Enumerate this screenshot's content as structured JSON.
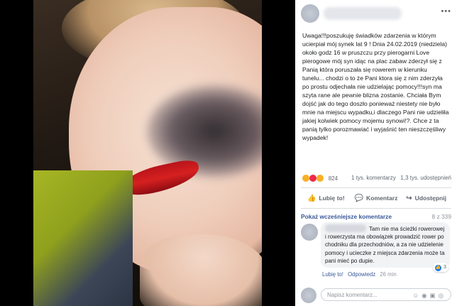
{
  "photo": {},
  "post": {
    "text": "Uwaga!!!poszukuję świadków zdarzenia w którym ucierpiał mój synek lat 9 ! Dnia 24.02.2019 (niedziela) około godz 16 w pruszczu przy pierogarni Love pierogowe mój syn idąc na plac zabaw zderzył się z Panią która poruszała się rowerem w kierunku tunelu... chodzi o to że Pani ktora się z nim zderzyła po prostu odjechała nie udzielając pomocy!!!syn ma szyta rane ale pewnie blizna zostanie. Chciała Bym dojść jak do tego doszło ponieważ niestety nie było mnie na miejscu wypadku,i dlaczego Pani nie udzieliła jakiej kolwiek pomocy mojemu synowi!?. Chce z ta panią tylko porozmawiać i wyjaśnić ten nieszczęśliwy wypadek!",
    "reactions_count": "824",
    "comments_count": "1 tys. komentarzy",
    "shares_count": "1,3 tys. udostępnień",
    "reaction_colors": [
      "#f7b125",
      "#f02849",
      "#f7b125"
    ]
  },
  "actions": {
    "like": "Lubię to!",
    "comment": "Komentarz",
    "share": "Udostępnij"
  },
  "comments": {
    "show_previous": "Pokaż wcześniejsze komentarze",
    "pager": "8 z 339",
    "first": {
      "text": "Tam nie ma ścieżki rowerowej i rowerzysta ma obowiązek prowadzić rower po chodniku dla przechodniów, a za nie udzielenie pomocy i ucieczke z miejsca zdarzenia może ta pani mieć po dupie.",
      "like_count": "3",
      "like_label": "Lubię to!",
      "reply_label": "Odpowiedz",
      "time": "26 min"
    },
    "input_placeholder": "Napisz komentarz..."
  }
}
